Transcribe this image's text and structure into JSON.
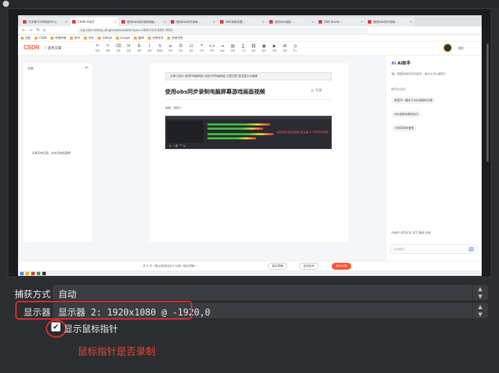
{
  "browser": {
    "tabs": [
      {
        "title": "写文章-CSDN创作中心"
      },
      {
        "title": "CSDN AI助手"
      },
      {
        "title": "使用obs同步录制电脑..."
      },
      {
        "title": "使用obs同步录制..."
      },
      {
        "title": "OBS录屏设置..."
      },
      {
        "title": "使用obs录屏..."
      },
      {
        "title": "OBS Studio..."
      },
      {
        "title": "使用obs同步录制..."
      }
    ],
    "url": "mp.csdn.net/mp_blog/creation/editor?spm=1000.2115.3001.4503",
    "bookmarks": [
      "百度",
      "CSDN",
      "哔哩哔哩",
      "知乎",
      "京东",
      "GitHub",
      "Google",
      "翻译",
      "谷歌学术",
      "其他书签"
    ]
  },
  "editor": {
    "logo": "CSDN",
    "back_label": "〈 发布文章",
    "tools": [
      {
        "glyph": "↶",
        "label": "撤销"
      },
      {
        "glyph": "↷",
        "label": "重做"
      },
      {
        "glyph": "⌫",
        "label": "清除"
      },
      {
        "glyph": "H",
        "label": "标题"
      },
      {
        "glyph": "B",
        "label": "加粗"
      },
      {
        "glyph": "I",
        "label": "斜体"
      },
      {
        "glyph": "S",
        "label": "删除线"
      },
      {
        "glyph": "≡",
        "label": "列表"
      },
      {
        "glyph": "☰",
        "label": "有序"
      },
      {
        "glyph": "☑",
        "label": "待办"
      },
      {
        "glyph": "❝",
        "label": "引用"
      },
      {
        "glyph": "<>",
        "label": "代码"
      },
      {
        "glyph": "⇥",
        "label": "缩进"
      },
      {
        "glyph": "▤",
        "label": "表格"
      },
      {
        "glyph": "∑",
        "label": "公式"
      },
      {
        "glyph": "⛓",
        "label": "链接"
      },
      {
        "glyph": "▣",
        "label": "图片"
      },
      {
        "glyph": "▶",
        "label": "视频"
      },
      {
        "glyph": "⌘",
        "label": "模板"
      },
      {
        "glyph": "◎",
        "label": "导入"
      }
    ],
    "user": "我的",
    "outline_title": "目录",
    "outline_empty": "文章没有目录，快去添加标题吧",
    "alert": "文章已保存 使用MD编辑器  切换为MD编辑器  主题设置  使用富文本编辑",
    "alert_link": "切换编辑器",
    "doc_title": "使用obs同步录制电脑屏幕游戏画面视频",
    "doc_tag": "◎ 文章",
    "doc_para": "效果：(图片)",
    "obs_overlay_text": "鼠标指针是否录制  显示器 2: 1920x1080",
    "obs_bottom": "+ - ⚙ ^ v",
    "bottom_info": "共 0 字 | 预计阅读时间 0 分钟  |  保存草稿 ✓",
    "btn_draft": "保存草稿",
    "btn_schedule": "定时发布",
    "btn_publish": "发布文章"
  },
  "assistant": {
    "title": "AI助手",
    "subtitle": "嗨，我是你的AI写作助手，有什么可以帮你？",
    "section": "你可以试试",
    "pills": [
      "帮我写一篇关于obs录屏的文章",
      "obs录屏有哪些技巧",
      "介绍OBS的使用"
    ],
    "footer": "AI创作  改写优化  续写  翻译  总结",
    "input_label": "向AI提问"
  },
  "properties": {
    "capture_method_label": "捕获方式",
    "capture_method_value": "自动",
    "display_label": "显示器",
    "display_value": "显示器 2: 1920x1080 @ -1920,0",
    "show_cursor_label": "显示鼠标指针",
    "show_cursor_checked": true
  },
  "annotation": {
    "note": "鼠标指针是否录制",
    "color": "#e02e2e"
  }
}
